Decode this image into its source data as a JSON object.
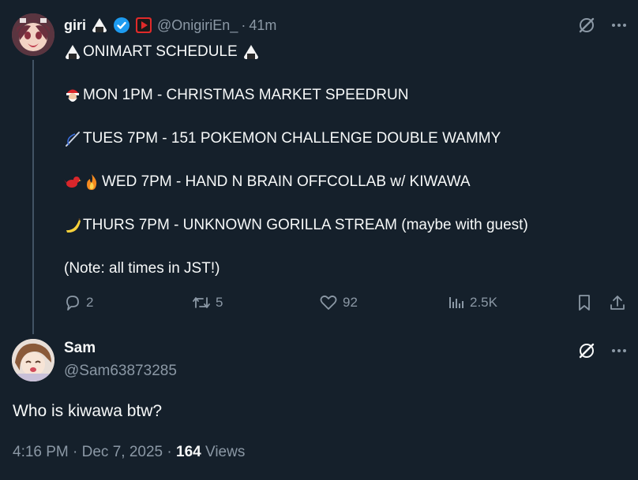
{
  "tweet": {
    "author_name": "giri",
    "handle": "@OnigiriEn_",
    "separator": "·",
    "time": "41m",
    "lines": [
      "ONIMART SCHEDULE",
      "MON 1PM - CHRISTMAS MARKET SPEEDRUN",
      "TUES 7PM - 151 POKEMON CHALLENGE DOUBLE WAMMY",
      "WED 7PM - HAND N BRAIN OFFCOLLAB w/ KIWAWA",
      "THURS 7PM - UNKNOWN GORILLA STREAM (maybe with guest)",
      "(Note: all times in JST!)"
    ],
    "actions": {
      "replies": "2",
      "reposts": "5",
      "likes": "92",
      "views": "2.5K"
    }
  },
  "reply": {
    "author_name": "Sam",
    "handle": "@Sam63873285",
    "text": "Who is kiwawa btw?",
    "timestamp": "4:16 PM · Dec 7, 2025 ·",
    "views_count": "164",
    "views_label": "Views"
  },
  "colors": {
    "background": "#15202b",
    "text": "#f7f9f9",
    "muted": "#8b98a5",
    "verified": "#1d9bf0",
    "thread_line": "#425364"
  },
  "icons": [
    "onigiri-icon",
    "verified-badge-icon",
    "youtube-play-icon",
    "grok-icon",
    "more-icon",
    "santa-emoji",
    "needle-emoji",
    "bird-emoji",
    "fire-emoji",
    "banana-emoji",
    "reply-icon",
    "repost-icon",
    "like-icon",
    "views-icon",
    "bookmark-icon",
    "share-icon"
  ]
}
